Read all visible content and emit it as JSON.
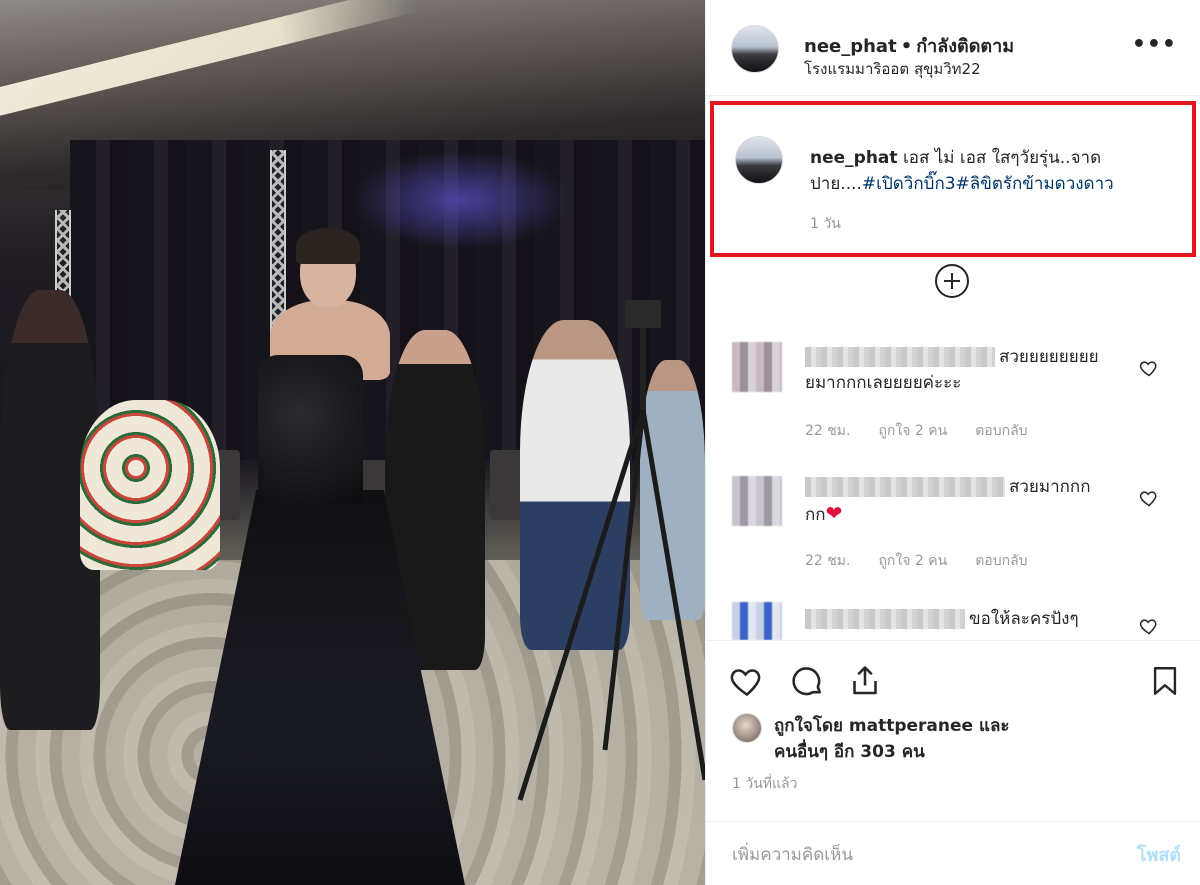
{
  "header": {
    "username": "nee_phat",
    "separator": "•",
    "follow_status": "กำลังติดตาม",
    "location": "โรงแรมมาริออต สุขุมวิท22",
    "more_label": "•••"
  },
  "caption": {
    "username": "nee_phat",
    "text": "เอส ไม่ เอส ใสๆวัยรุ่น..จาดปาย....",
    "hashtags": "#เปิดวิกบิ๊ก3#ลิขิตรักข้ามดวงดาว",
    "time": "1 วัน"
  },
  "comments": [
    {
      "text": "สวยยยยยยยยยมากกกเลยยยยค่ะะะ",
      "time": "22 ชม.",
      "likes": "ถูกใจ 2 คน",
      "reply": "ตอบกลับ"
    },
    {
      "text": "สวยมากกกกก",
      "emoji": "❤",
      "time": "22 ชม.",
      "likes": "ถูกใจ 2 คน",
      "reply": "ตอบกลับ"
    },
    {
      "text": "ขอให้ละครปังๆ"
    }
  ],
  "likes": {
    "prefix": "ถูกใจโดย",
    "user": "mattperanee",
    "and": "และ",
    "others": "คนอื่นๆ อีก 303 คน"
  },
  "post_date": "1 วันที่แล้ว",
  "add_comment": {
    "placeholder": "เพิ่มความคิดเห็น",
    "post_label": "โพสต์"
  },
  "colors": {
    "highlight_border": "#e3161d",
    "hashtag": "#003569",
    "post_button": "#b2dffc",
    "muted": "#999999"
  },
  "icons": [
    "more-icon",
    "load-more-plus-icon",
    "heart-icon",
    "comment-icon",
    "share-icon",
    "bookmark-icon"
  ]
}
